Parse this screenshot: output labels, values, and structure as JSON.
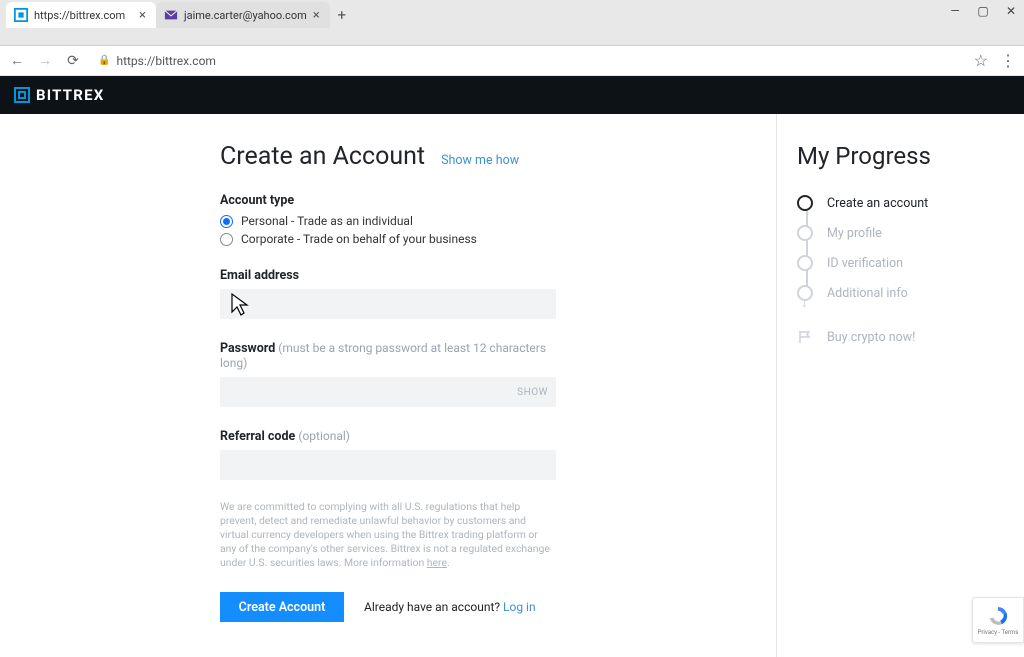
{
  "browser": {
    "tabs": [
      {
        "label": "https://bittrex.com",
        "active": true
      },
      {
        "label": "jaime.carter@yahoo.com",
        "active": false
      }
    ],
    "url_display": "https://bittrex.com"
  },
  "brand": {
    "name": "BITTREX"
  },
  "form": {
    "heading": "Create an Account",
    "show_me_how": "Show me how",
    "account_type_label": "Account type",
    "radio_personal": "Personal - Trade as an individual",
    "radio_corporate": "Corporate - Trade on behalf of your business",
    "email_label": "Email address",
    "email_value": "",
    "password_label": "Password",
    "password_hint": " (must be a strong password at least 12 characters long)",
    "password_value": "",
    "show_button": "SHOW",
    "referral_label": "Referral code ",
    "referral_hint": "(optional)",
    "referral_value": "",
    "legal_text": "We are committed to complying with all U.S. regulations that help prevent, detect and remediate unlawful behavior by customers and virtual currency developers when using the Bittrex trading platform or any of the company's other services. Bittrex is not a regulated exchange under U.S. securities laws. More information ",
    "legal_here": "here",
    "legal_period": ".",
    "create_button": "Create Account",
    "already_text": "Already have an account? ",
    "login_link": "Log in"
  },
  "progress": {
    "heading": "My Progress",
    "steps": [
      {
        "label": "Create an account",
        "active": true
      },
      {
        "label": "My profile",
        "active": false
      },
      {
        "label": "ID verification",
        "active": false
      },
      {
        "label": "Additional info",
        "active": false
      }
    ],
    "final": "Buy crypto now!"
  },
  "recaptcha": {
    "privacy": "Privacy",
    "terms": "Terms"
  }
}
